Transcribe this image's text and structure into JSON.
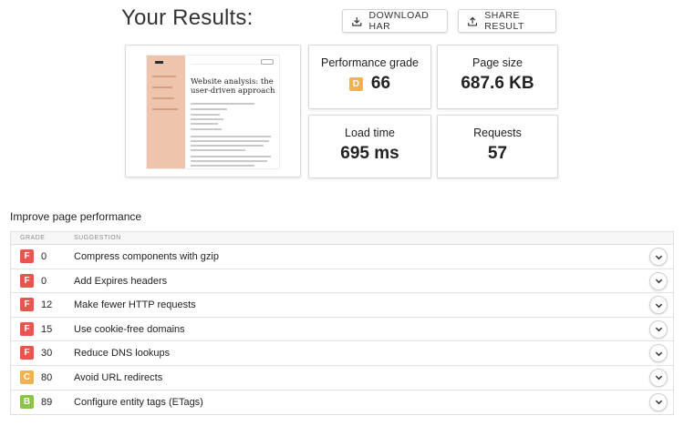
{
  "header": {
    "title": "Your Results:",
    "download_label": "DOWNLOAD HAR",
    "share_label": "SHARE RESULT"
  },
  "screenshot_preview": {
    "heading": "Website analysis: the user-driven approach"
  },
  "metrics": {
    "grade_label": "Performance grade",
    "grade_letter": "D",
    "grade_value": "66",
    "size_label": "Page size",
    "size_value": "687.6 KB",
    "load_label": "Load time",
    "load_value": "695 ms",
    "requests_label": "Requests",
    "requests_value": "57"
  },
  "improve": {
    "title": "Improve page performance",
    "col_grade": "GRADE",
    "col_suggestion": "SUGGESTION",
    "rows": [
      {
        "grade": "F",
        "score": "0",
        "suggestion": "Compress components with gzip"
      },
      {
        "grade": "F",
        "score": "0",
        "suggestion": "Add Expires headers"
      },
      {
        "grade": "F",
        "score": "12",
        "suggestion": "Make fewer HTTP requests"
      },
      {
        "grade": "F",
        "score": "15",
        "suggestion": "Use cookie-free domains"
      },
      {
        "grade": "F",
        "score": "30",
        "suggestion": "Reduce DNS lookups"
      },
      {
        "grade": "C",
        "score": "80",
        "suggestion": "Avoid URL redirects"
      },
      {
        "grade": "B",
        "score": "89",
        "suggestion": "Configure entity tags (ETags)"
      }
    ]
  },
  "colors": {
    "grade_F": "#e8554e",
    "grade_D": "#f0b24f",
    "grade_C": "#f0b24f",
    "grade_B": "#8bc34a"
  },
  "icons": {
    "download": "download-icon",
    "share": "share-icon",
    "expand": "chevron-down-icon"
  }
}
